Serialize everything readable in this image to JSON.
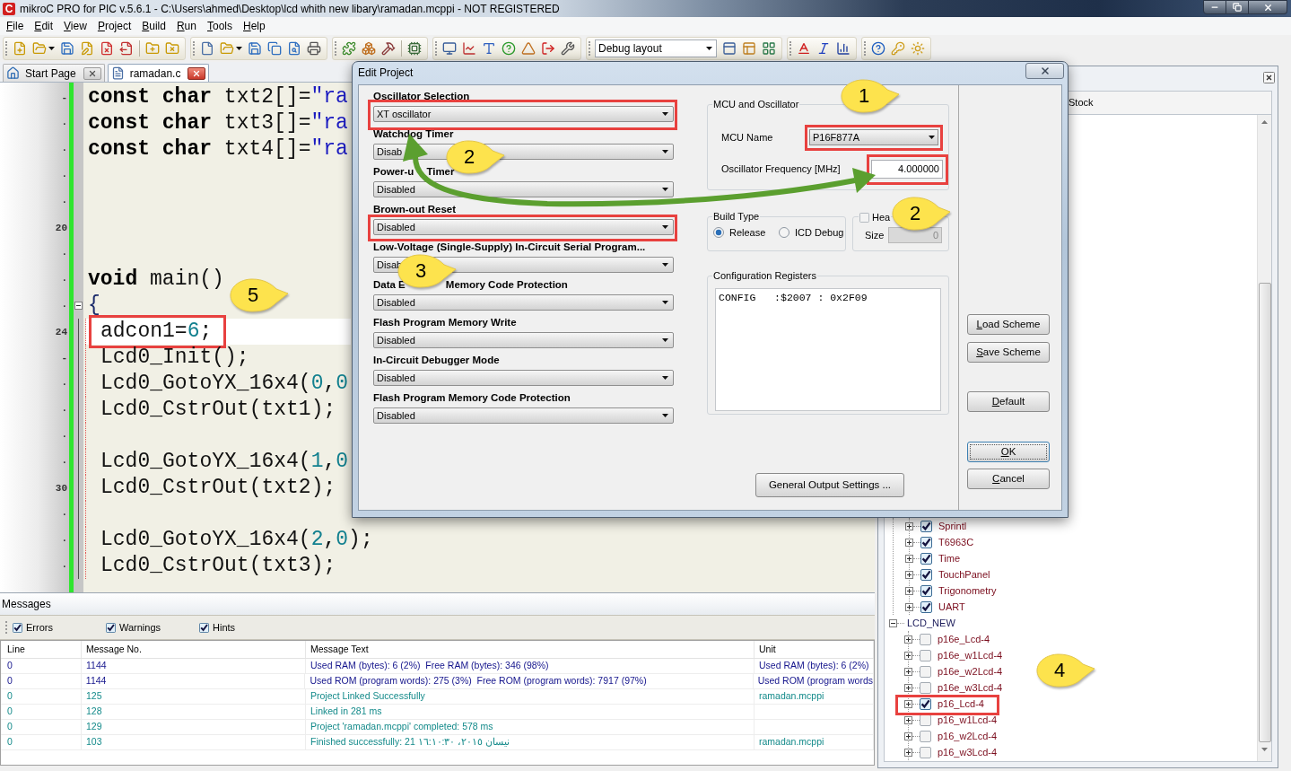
{
  "window": {
    "logo": "C",
    "title": "mikroC PRO for PIC v.5.6.1 - C:\\Users\\ahmed\\Desktop\\lcd whith new libary\\ramadan.mcppi - NOT REGISTERED"
  },
  "menu": [
    "File",
    "Edit",
    "View",
    "Project",
    "Build",
    "Run",
    "Tools",
    "Help"
  ],
  "toolbar": {
    "layout_combo": "Debug layout"
  },
  "tabs": [
    {
      "kind": "start",
      "label": "Start Page",
      "selected": false
    },
    {
      "kind": "source",
      "label": "ramadan.c",
      "selected": true
    }
  ],
  "editor": {
    "lines": [
      {
        "gutter": "-",
        "current": false,
        "foldable": false,
        "indented": false,
        "tokens": [
          {
            "kind": "keyword",
            "text": "const char"
          },
          {
            "kind": "plain",
            "text": " txt2[]="
          },
          {
            "kind": "string",
            "text": "\"ra"
          }
        ]
      },
      {
        "gutter": "·",
        "current": false,
        "foldable": false,
        "indented": false,
        "tokens": [
          {
            "kind": "keyword",
            "text": "const char"
          },
          {
            "kind": "plain",
            "text": " txt3[]="
          },
          {
            "kind": "string",
            "text": "\"ra"
          }
        ]
      },
      {
        "gutter": "·",
        "current": false,
        "foldable": false,
        "indented": false,
        "tokens": [
          {
            "kind": "keyword",
            "text": "const char"
          },
          {
            "kind": "plain",
            "text": " txt4[]="
          },
          {
            "kind": "string",
            "text": "\"ra"
          }
        ]
      },
      {
        "gutter": "·",
        "current": false,
        "foldable": false
      },
      {
        "gutter": "·",
        "current": false,
        "foldable": false
      },
      {
        "gutter": "20",
        "current": false,
        "foldable": false
      },
      {
        "gutter": "·",
        "current": false,
        "foldable": false
      },
      {
        "gutter": "·",
        "current": false,
        "foldable": false,
        "indented": false,
        "tokens": [
          {
            "kind": "keyword",
            "text": "void"
          },
          {
            "kind": "plain",
            "text": " main()"
          }
        ]
      },
      {
        "gutter": "·",
        "current": false,
        "foldable": true,
        "indented": false,
        "tokens": [
          {
            "kind": "brace",
            "text": "{"
          }
        ]
      },
      {
        "gutter": "24",
        "current": true,
        "foldable": false,
        "indented": true,
        "tokens": [
          {
            "kind": "plain",
            "text": "adcon1="
          },
          {
            "kind": "number",
            "text": "6"
          },
          {
            "kind": "plain",
            "text": ";"
          }
        ]
      },
      {
        "gutter": "-",
        "current": false,
        "foldable": false,
        "indented": true,
        "tokens": [
          {
            "kind": "plain",
            "text": "Lcd0_Init();"
          }
        ]
      },
      {
        "gutter": "·",
        "current": false,
        "foldable": false,
        "indented": true,
        "tokens": [
          {
            "kind": "plain",
            "text": "Lcd0_GotoYX_16x4("
          },
          {
            "kind": "number",
            "text": "0"
          },
          {
            "kind": "plain",
            "text": ","
          },
          {
            "kind": "number",
            "text": "0"
          }
        ]
      },
      {
        "gutter": "·",
        "current": false,
        "foldable": false,
        "indented": true,
        "tokens": [
          {
            "kind": "plain",
            "text": "Lcd0_CstrOut(txt1);"
          }
        ]
      },
      {
        "gutter": "·",
        "current": false,
        "foldable": false
      },
      {
        "gutter": "·",
        "current": false,
        "foldable": false,
        "indented": true,
        "tokens": [
          {
            "kind": "plain",
            "text": "Lcd0_GotoYX_16x4("
          },
          {
            "kind": "number",
            "text": "1"
          },
          {
            "kind": "plain",
            "text": ","
          },
          {
            "kind": "number",
            "text": "0"
          }
        ]
      },
      {
        "gutter": "30",
        "current": false,
        "foldable": false,
        "indented": true,
        "tokens": [
          {
            "kind": "plain",
            "text": "Lcd0_CstrOut(txt2);"
          }
        ]
      },
      {
        "gutter": "·",
        "current": false,
        "foldable": false
      },
      {
        "gutter": "·",
        "current": false,
        "foldable": false,
        "indented": true,
        "tokens": [
          {
            "kind": "plain",
            "text": "Lcd0_GotoYX_16x4("
          },
          {
            "kind": "number",
            "text": "2"
          },
          {
            "kind": "plain",
            "text": ","
          },
          {
            "kind": "number",
            "text": "0"
          },
          {
            "kind": "plain",
            "text": ");"
          }
        ]
      },
      {
        "gutter": "·",
        "current": false,
        "foldable": false,
        "indented": true,
        "tokens": [
          {
            "kind": "plain",
            "text": "Lcd0_CstrOut(txt3);"
          }
        ]
      }
    ]
  },
  "messages": {
    "title": "Messages",
    "filters": [
      {
        "label": "Errors",
        "checked": true
      },
      {
        "label": "Warnings",
        "checked": true
      },
      {
        "label": "Hints",
        "checked": true
      }
    ],
    "columns": [
      "Line",
      "Message No.",
      "Message Text",
      "Unit"
    ],
    "rows": [
      {
        "kind": "info",
        "cells": [
          "0",
          "1144",
          "Used RAM (bytes): 6 (2%)  Free RAM (bytes): 346 (98%)",
          "Used RAM (bytes): 6 (2%)"
        ]
      },
      {
        "kind": "info",
        "cells": [
          "0",
          "1144",
          "Used ROM (program words): 275 (3%)  Free ROM (program words): 7917 (97%)",
          "Used ROM (program words"
        ]
      },
      {
        "kind": "hint",
        "cells": [
          "0",
          "125",
          "Project Linked Successfully",
          "ramadan.mcppi"
        ]
      },
      {
        "kind": "hint",
        "cells": [
          "0",
          "128",
          "Linked in 281 ms"
        ]
      },
      {
        "kind": "hint",
        "cells": [
          "0",
          "129",
          "Project 'ramadan.mcppi' completed: 578 ms"
        ]
      },
      {
        "kind": "hint",
        "cells": [
          "0",
          "103",
          "Finished successfully: 21 نيسان ٢٠١٥، ١٦:١٠:٣٠",
          "ramadan.mcppi"
        ]
      }
    ]
  },
  "library_manager": {
    "column_header": "Stock",
    "tree": [
      {
        "children": [
          {
            "label": "Sprintl",
            "checked": true,
            "expanded": false
          },
          {
            "label": "T6963C",
            "checked": true,
            "expanded": false
          },
          {
            "label": "Time",
            "checked": true,
            "expanded": false
          },
          {
            "label": "TouchPanel",
            "checked": true,
            "expanded": false
          },
          {
            "label": "Trigonometry",
            "checked": true,
            "expanded": false
          },
          {
            "label": "UART",
            "checked": true,
            "expanded": false
          }
        ]
      },
      {
        "label": "LCD_NEW",
        "expanded": true,
        "children": [
          {
            "label": "p16e_Lcd-4",
            "checked": false,
            "expanded": false
          },
          {
            "label": "p16e_w1Lcd-4",
            "checked": false,
            "expanded": false
          },
          {
            "label": "p16e_w2Lcd-4",
            "checked": false,
            "expanded": false
          },
          {
            "label": "p16e_w3Lcd-4",
            "checked": false,
            "expanded": false
          },
          {
            "label": "p16_Lcd-4",
            "checked": true,
            "expanded": false
          },
          {
            "label": "p16_w1Lcd-4",
            "checked": false,
            "expanded": false
          },
          {
            "label": "p16_w2Lcd-4",
            "checked": false,
            "expanded": false
          },
          {
            "label": "p16_w3Lcd-4",
            "checked": false,
            "expanded": false
          }
        ]
      }
    ]
  },
  "dialog": {
    "title": "Edit Project",
    "fields": [
      {
        "label": [
          "Oscillator Selection"
        ],
        "value": "XT oscillator"
      },
      {
        "label": [
          "Watchdog Timer"
        ],
        "value": "Disab"
      },
      {
        "label": [
          "Power-u",
          "Timer"
        ],
        "value": "Disabled"
      },
      {
        "label": [
          "Brown-out Reset"
        ],
        "value": "Disabled"
      },
      {
        "label": [
          "Low-Voltage (Single-Supply) In-Circuit Serial Program..."
        ],
        "value": "Disab"
      },
      {
        "label": [
          "Data E",
          "Memory Code Protection"
        ],
        "value": "Disabled"
      },
      {
        "label": [
          "Flash Program Memory Write"
        ],
        "value": "Disabled"
      },
      {
        "label": [
          "In-Circuit Debugger Mode"
        ],
        "value": "Disabled"
      },
      {
        "label": [
          "Flash Program Memory Code Protection"
        ],
        "value": "Disabled"
      }
    ],
    "mcu": {
      "legend": "MCU and Oscillator",
      "name_label": "MCU Name",
      "name_value": "P16F877A",
      "freq_label": "Oscillator Frequency [MHz]",
      "freq_value": "4.000000"
    },
    "build_type": {
      "legend": "Build Type",
      "options": [
        {
          "label": "Release",
          "selected": true
        },
        {
          "label": "ICD Debug",
          "selected": false
        }
      ]
    },
    "heap": {
      "label": "Hea",
      "checked": false,
      "size_label": "Size",
      "size_value": "0",
      "size_disabled": true
    },
    "config": {
      "legend": "Configuration Registers",
      "text": "CONFIG   :$2007 : 0x2F09"
    },
    "output_button": "General Output Settings ...",
    "buttons": [
      {
        "label": "Load Scheme",
        "mnemonic": true,
        "focused": false
      },
      {
        "label": "Save Scheme",
        "mnemonic": true,
        "focused": false
      },
      {
        "label": "Default",
        "mnemonic": true,
        "focused": false
      },
      {
        "label": "OK",
        "mnemonic": true,
        "focused": true
      },
      {
        "label": "Cancel",
        "mnemonic": true,
        "focused": false
      }
    ]
  },
  "callouts": [
    "1",
    "2",
    "2",
    "3",
    "5",
    "4"
  ]
}
